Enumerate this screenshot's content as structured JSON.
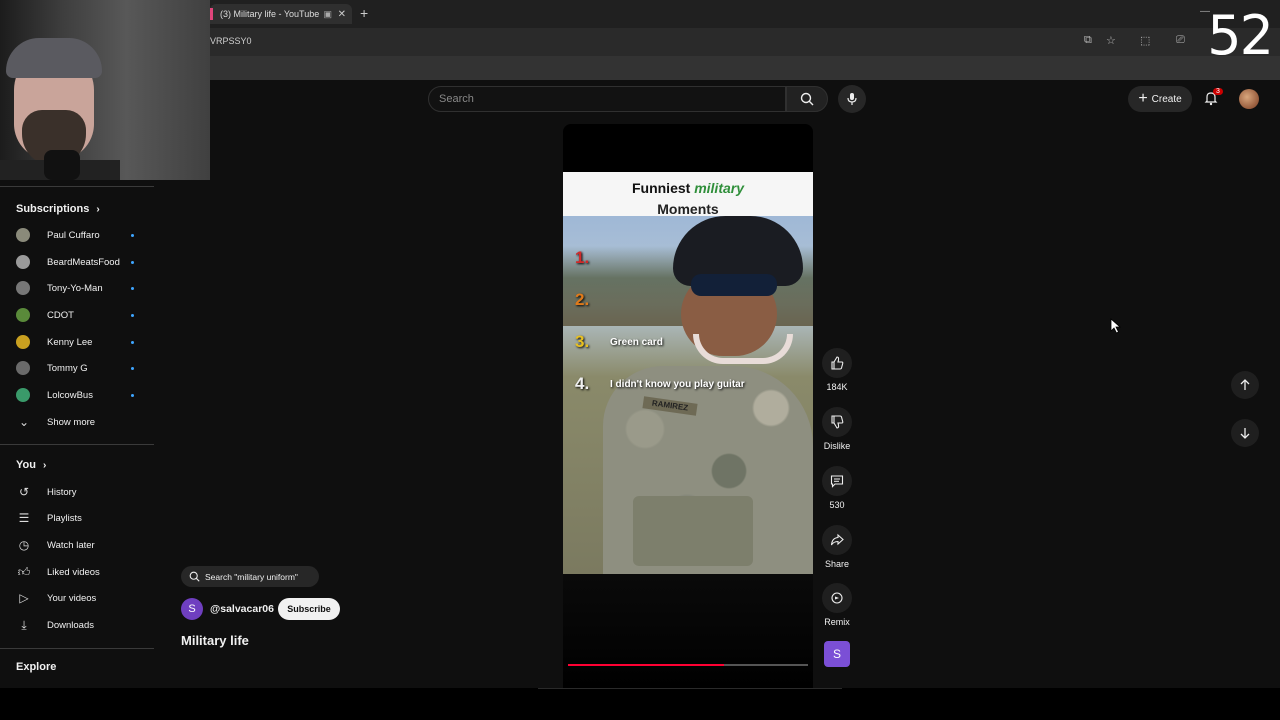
{
  "browser": {
    "tab_title": "(3) Military life - YouTube",
    "url": "VRPSSY0",
    "new_tab": "+",
    "counter": "52"
  },
  "header": {
    "search_placeholder": "Search",
    "create_label": "Create",
    "notification_count": "3"
  },
  "sidebar": {
    "subscriptions_title": "Subscriptions",
    "subscriptions": [
      {
        "name": "Paul Cuffaro",
        "color": "#8a8a7a"
      },
      {
        "name": "BeardMeatsFood",
        "color": "#9a9a9a"
      },
      {
        "name": "Tony-Yo-Man",
        "color": "#777777"
      },
      {
        "name": "CDOT",
        "color": "#5a8a3a"
      },
      {
        "name": "Kenny Lee",
        "color": "#c9a020"
      },
      {
        "name": "Tommy G",
        "color": "#6a6a6a"
      },
      {
        "name": "LolcowBus",
        "color": "#3a9a6a"
      }
    ],
    "show_more": "Show more",
    "you_title": "You",
    "you_items": [
      {
        "label": "History",
        "icon": "history-icon"
      },
      {
        "label": "Playlists",
        "icon": "playlists-icon"
      },
      {
        "label": "Watch later",
        "icon": "watch-later-icon"
      },
      {
        "label": "Liked videos",
        "icon": "liked-icon"
      },
      {
        "label": "Your videos",
        "icon": "your-videos-icon"
      },
      {
        "label": "Downloads",
        "icon": "downloads-icon"
      }
    ],
    "explore_title": "Explore"
  },
  "video": {
    "overlay_title_prefix": "Funniest ",
    "overlay_title_accent": "military",
    "overlay_title_line2": "Moments",
    "list": [
      {
        "num": "1.",
        "label": ""
      },
      {
        "num": "2.",
        "label": ""
      },
      {
        "num": "3.",
        "label": "Green card"
      },
      {
        "num": "4.",
        "label": "I didn't know you play guitar"
      }
    ],
    "nametape": "RAMIREZ",
    "progress": 0.65
  },
  "actions": {
    "likes": "184K",
    "dislike": "Dislike",
    "comments": "530",
    "share": "Share",
    "remix": "Remix",
    "channel_initial": "S"
  },
  "info": {
    "search_chip": "Search \"military uniform\"",
    "channel_initial": "S",
    "channel_handle": "@salvacar06",
    "subscribe": "Subscribe",
    "video_title": "Military life"
  }
}
